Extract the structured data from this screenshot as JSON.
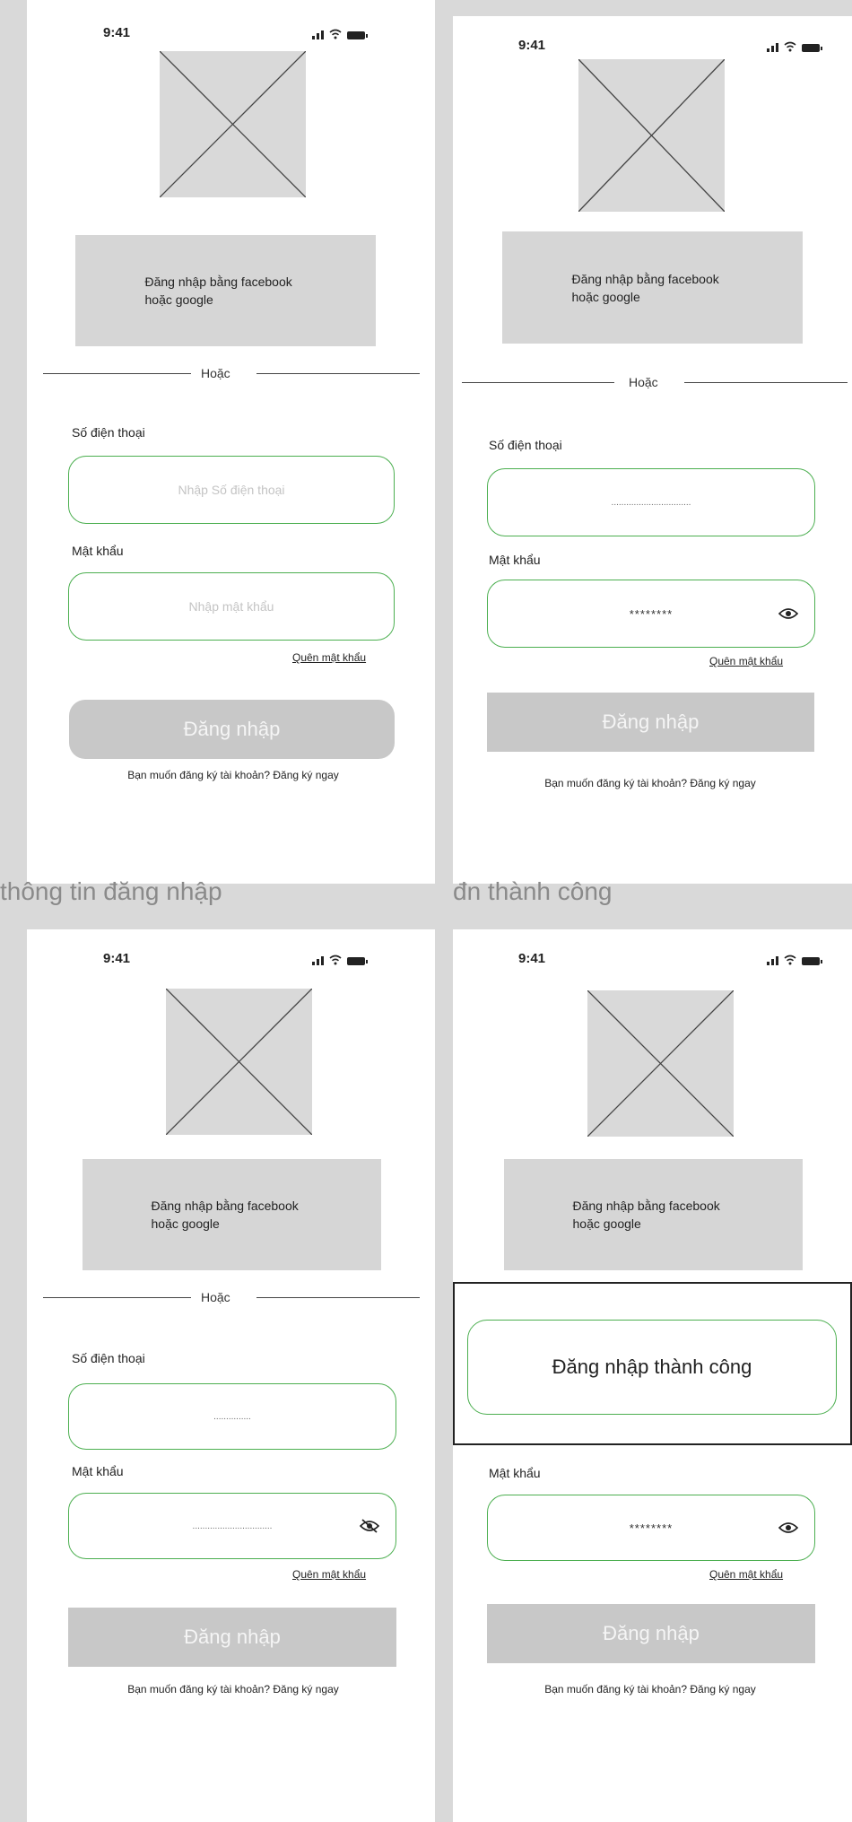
{
  "status_bar": {
    "time": "9:41"
  },
  "social_text": "Đăng nhập bằng facebook\nhoặc google",
  "divider_text": "Hoặc",
  "phone_label": "Số điện thoại",
  "phone_placeholder": "Nhập Số điện thoại",
  "password_label": "Mật khẩu",
  "password_placeholder": "Nhập mật khẩu",
  "phone_masked": "................................",
  "phone_masked_short": "...............",
  "password_masked": "********",
  "password_masked_long": "................................",
  "forgot_password": "Quên mật khẩu",
  "login_button": "Đăng nhập",
  "register_text": "Bạn muốn đăng ký tài khoản? Đăng ký ngay",
  "captions": {
    "left": "thông tin đăng nhập",
    "right": "đn thành công"
  },
  "success_message": "Đăng nhập thành công",
  "colors": {
    "field_border": "#4caf50",
    "button_bg": "#c8c8c8",
    "placeholder_fill": "#d9d9d9"
  }
}
